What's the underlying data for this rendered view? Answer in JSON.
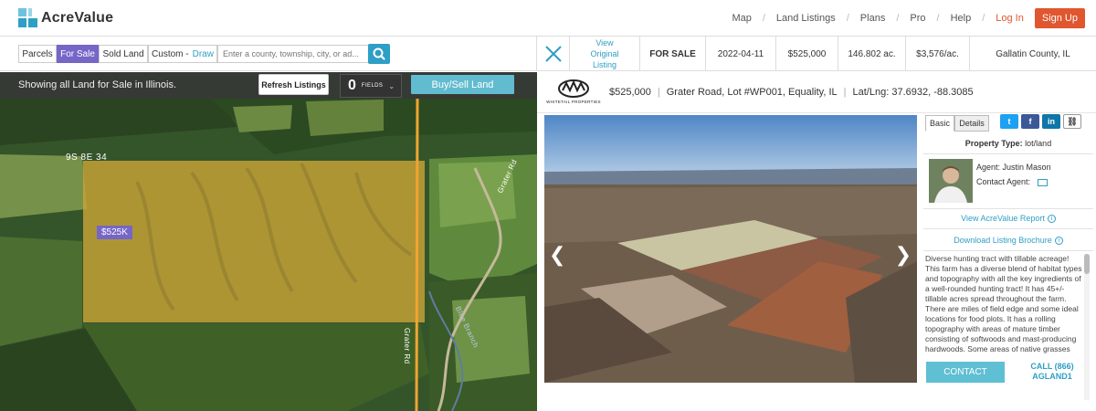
{
  "brand": {
    "name": "AcreValue"
  },
  "nav": {
    "items": [
      "Map",
      "Land Listings",
      "Plans",
      "Pro",
      "Help"
    ],
    "login": "Log In",
    "signup": "Sign Up"
  },
  "filters": {
    "parcels": "Parcels",
    "for_sale": "For Sale",
    "sold_land": "Sold Land",
    "custom": "Custom -",
    "draw": "Draw",
    "search_placeholder": "Enter a county, township, city, or ad..."
  },
  "map": {
    "status": "Showing all Land for Sale in Illinois.",
    "refresh": "Refresh Listings",
    "fields_count": "0",
    "fields_label": "FIELDS",
    "buy_sell": "Buy/Sell Land",
    "parcel_label": "9S 8E 34",
    "price_tag": "$525K",
    "road1": "Grater Rd",
    "road2": "Grater Rd",
    "creek": "Blue Branch"
  },
  "listing_bar": {
    "view_original": "View Original Listing",
    "status": "FOR SALE",
    "date": "2022-04-11",
    "price": "$525,000",
    "acres": "146.802 ac.",
    "per_acre": "$3,576/ac.",
    "county": "Gallatin County, IL"
  },
  "detail": {
    "logo_text": "WHITETAIL PROPERTIES",
    "price": "$525,000",
    "address": "Grater Road, Lot #WP001, Equality, IL",
    "latlng_label": "Lat/Lng:",
    "latlng": "37.6932, -88.3085",
    "tabs": [
      "Basic",
      "Details"
    ],
    "property_type_label": "Property Type:",
    "property_type": "lot/land",
    "agent_label": "Agent:",
    "agent_name": "Justin Mason",
    "contact_agent": "Contact Agent:",
    "report_link": "View AcreValue Report",
    "brochure_link": "Download Listing Brochure",
    "description": "Diverse hunting tract with tillable acreage! This farm has a diverse blend of habitat types and topography with all the key ingredients of a well-rounded hunting tract! It has 45+/- tillable acres spread throughout the farm. There are miles of field edge and some ideal locations for food plots. It has a rolling topography with areas of mature timber consisting of softwoods and mast-producing hardwoods. Some areas of native grasses",
    "contact_btn": "CONTACT",
    "call_btn": "CALL (866) AGLAND1"
  },
  "colors": {
    "accent": "#2e9fc5",
    "purple": "#7566c7",
    "orange": "#e0562f"
  }
}
